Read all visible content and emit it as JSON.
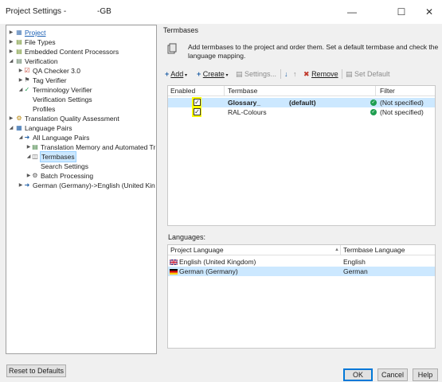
{
  "window": {
    "title": "Project Settings -              -GB",
    "minimize_glyph": "—",
    "maximize_glyph": "☐",
    "close_glyph": "✕"
  },
  "tree": {
    "project": "Project",
    "file_types": "File Types",
    "embedded": "Embedded Content Processors",
    "verification": "Verification",
    "qa_checker": "QA Checker 3.0",
    "tag_verifier": "Tag Verifier",
    "terminology_verifier": "Terminology Verifier",
    "verification_settings": "Verification Settings",
    "profiles": "Profiles",
    "tqa": "Translation Quality Assessment",
    "language_pairs": "Language Pairs",
    "all_language_pairs": "All Language Pairs",
    "tm_automated": "Translation Memory and Automated Tr",
    "termbases": "Termbases",
    "search_settings": "Search Settings",
    "batch_processing": "Batch Processing",
    "german_english": "German (Germany)->English (United Kin"
  },
  "section": {
    "title": "Termbases",
    "description": "Add termbases to the project and order them. Set a default termbase and check the language mapping."
  },
  "toolbar": {
    "add": "Add",
    "create": "Create",
    "settings": "Settings...",
    "remove": "Remove",
    "set_default": "Set Default"
  },
  "termbase_grid": {
    "headers": {
      "enabled": "Enabled",
      "termbase": "Termbase",
      "filter": "Filter"
    },
    "rows": [
      {
        "name": "Glossary_",
        "suffix": "(default)",
        "filter": "(Not specified)"
      },
      {
        "name": "RAL-Colours",
        "filter": "(Not specified)"
      }
    ]
  },
  "languages": {
    "label": "Languages:",
    "headers": {
      "project_language": "Project Language",
      "termbase_language": "Termbase Language"
    },
    "rows": [
      {
        "project": "English (United Kingdom)",
        "termbase": "English"
      },
      {
        "project": "German (Germany)",
        "termbase": "German"
      }
    ]
  },
  "buttons": {
    "reset": "Reset to Defaults",
    "ok": "OK",
    "cancel": "Cancel",
    "help": "Help"
  }
}
